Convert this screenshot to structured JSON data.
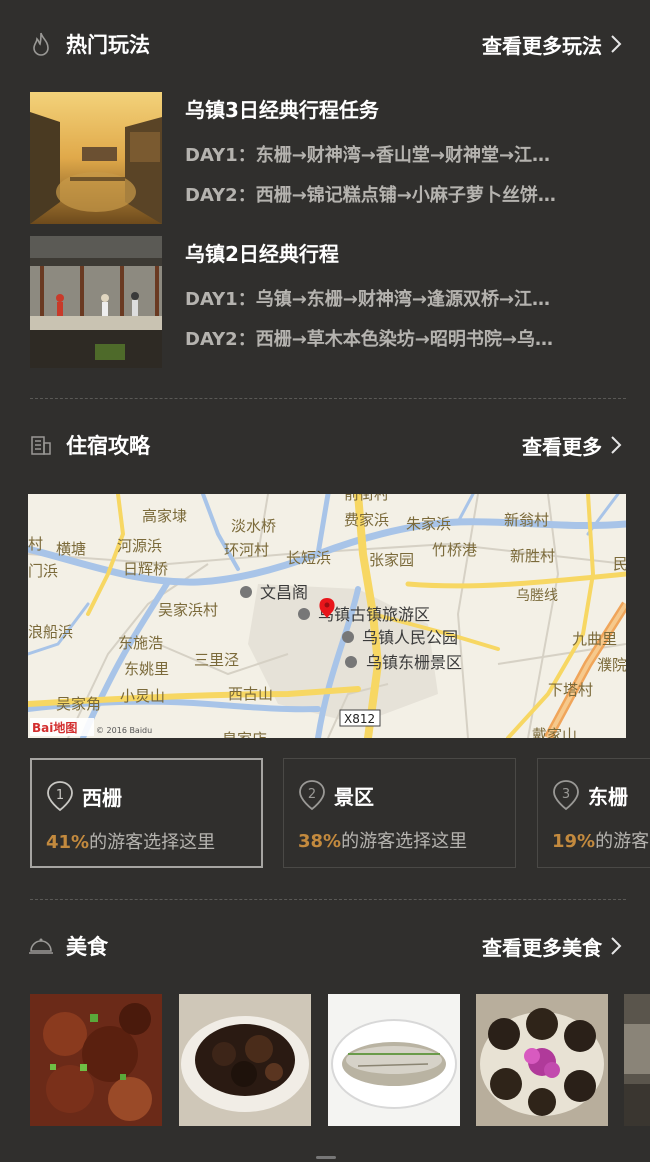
{
  "hot_routes": {
    "title": "热门玩法",
    "more": "查看更多玩法",
    "items": [
      {
        "title": "乌镇3日经典行程任务",
        "day1": "DAY1：东栅→财神湾→香山堂→财神堂→江…",
        "day2": "DAY2：西栅→锦记糕点铺→小麻子萝卜丝饼…"
      },
      {
        "title": "乌镇2日经典行程",
        "day1": "DAY1：乌镇→东栅→财神湾→逢源双桥→江…",
        "day2": "DAY2：西栅→草木本色染坊→昭明书院→乌…"
      }
    ]
  },
  "lodging": {
    "title": "住宿攻略",
    "more": "查看更多",
    "map_labels": {
      "gaojiadai": "高家埭",
      "danshuiqiao": "淡水桥",
      "feijiabang": "费家浜",
      "zhujiabang": "朱家浜",
      "xinwengcun": "新翁村",
      "qianjiecun": "前街村",
      "cun": "村",
      "hengtang": "横塘",
      "heyuanbang": "河源浜",
      "huanhecun": "环河村",
      "changduanbang": "长短浜",
      "zhangjiayuan": "张家园",
      "zhuqiaogang": "竹桥港",
      "xinshengcun": "新胜村",
      "min": "民",
      "mbang": "门浜",
      "rihuiqiao": "日辉桥",
      "wenchangge": "文昌阁",
      "wutenxian": "乌塍线",
      "wujiabangcun": "吴家浜村",
      "scenic": "乌镇古镇旅游区",
      "jiuquli": "九曲里",
      "langchuanbang": "浪船浜",
      "dongshihao": "东施浩",
      "people_park": "乌镇人民公园",
      "puyuan": "濮院互",
      "dongyaoli": "东姚里",
      "sanlijing": "三里泾",
      "dongzha_scenic": "乌镇东栅景区",
      "wujiajiao": "吴家角",
      "xiaojiongshan": "小炅山",
      "xigushan": "西古山",
      "xiatacun": "下塔村",
      "road_x812": "X812",
      "huangjiadian": "皇家店",
      "daijiashan": "戴家山",
      "baidu_logo": "Bai地图",
      "copyright": "© 2016 Baidu"
    },
    "choices": [
      {
        "num": "1",
        "name": "西栅",
        "pct": "41%",
        "suffix": "的游客选择这里"
      },
      {
        "num": "2",
        "name": "景区",
        "pct": "38%",
        "suffix": "的游客选择这里"
      },
      {
        "num": "3",
        "name": "东栅",
        "pct": "19%",
        "suffix": "的游客选择这里"
      }
    ]
  },
  "food": {
    "title": "美食",
    "more": "查看更多美食"
  },
  "colors": {
    "background": "#302f2d",
    "accent": "#c38a3e",
    "muted_text": "#b5b3af",
    "map_marker": "#e8161b"
  },
  "icons": {
    "hot": "flame-icon",
    "lodging": "building-icon",
    "food": "cloche-icon",
    "more": "chevron-right-icon",
    "choice": "location-pin-icon"
  }
}
